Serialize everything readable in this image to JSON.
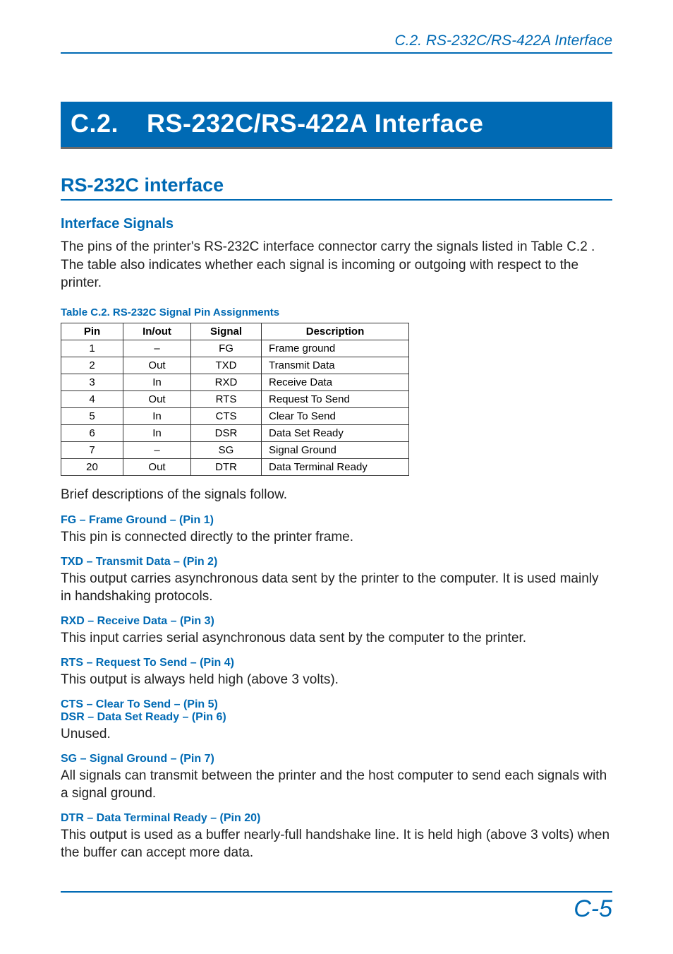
{
  "running_head": "C.2.  RS-232C/RS-422A Interface",
  "h1_number": "C.2.",
  "h1_title": "RS-232C/RS-422A Interface",
  "h2": "RS-232C interface",
  "h3": "Interface Signals",
  "intro": "The pins of the printer's RS-232C interface connector carry the signals listed in Table C.2 . The table also indicates whether each signal is incoming or outgoing with respect to the printer.",
  "table_caption": "Table C.2.  RS-232C Signal Pin Assignments",
  "table": {
    "headers": [
      "Pin",
      "In/out",
      "Signal",
      "Description"
    ],
    "rows": [
      {
        "pin": "1",
        "io": "–",
        "signal": "FG",
        "desc": "Frame ground"
      },
      {
        "pin": "2",
        "io": "Out",
        "signal": "TXD",
        "desc": "Transmit Data"
      },
      {
        "pin": "3",
        "io": "In",
        "signal": "RXD",
        "desc": "Receive Data"
      },
      {
        "pin": "4",
        "io": "Out",
        "signal": "RTS",
        "desc": "Request To Send"
      },
      {
        "pin": "5",
        "io": "In",
        "signal": "CTS",
        "desc": "Clear To Send"
      },
      {
        "pin": "6",
        "io": "In",
        "signal": "DSR",
        "desc": "Data Set Ready"
      },
      {
        "pin": "7",
        "io": "–",
        "signal": "SG",
        "desc": "Signal Ground"
      },
      {
        "pin": "20",
        "io": "Out",
        "signal": "DTR",
        "desc": "Data Terminal Ready"
      }
    ]
  },
  "post_table": "Brief descriptions of the signals follow.",
  "signals": [
    {
      "head": "FG – Frame Ground – (Pin 1)",
      "body": "This pin is connected directly to the printer frame."
    },
    {
      "head": "TXD – Transmit Data – (Pin 2)",
      "body": "This output carries asynchronous data sent by the printer to the computer. It is used mainly in handshaking protocols."
    },
    {
      "head": "RXD – Receive Data – (Pin 3)",
      "body": "This input carries serial asynchronous data sent by the computer to the printer."
    },
    {
      "head": "RTS – Request To Send – (Pin 4)",
      "body": "This output is always held high (above 3 volts)."
    },
    {
      "head": "CTS – Clear To Send – (Pin 5)\nDSR – Data Set Ready – (Pin 6)",
      "body": "Unused."
    },
    {
      "head": "SG – Signal Ground – (Pin 7)",
      "body": "All signals can transmit between the printer and the host computer to send each signals with a signal ground."
    },
    {
      "head": "DTR – Data Terminal Ready – (Pin 20)",
      "body": "This output is used as a buffer nearly-full handshake line. It is held high (above 3 volts) when the buffer can accept more data."
    }
  ],
  "page_number": "C-5"
}
